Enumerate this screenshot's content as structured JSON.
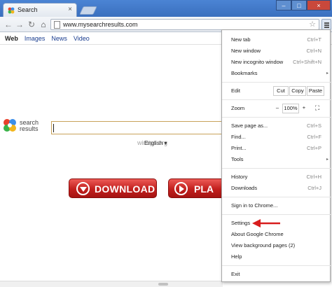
{
  "tab": {
    "title": "Search",
    "close": "×"
  },
  "toolbar": {
    "back": "←",
    "forward": "→",
    "reload": "↻",
    "home": "⌂",
    "url": "www.mysearchresults.com",
    "star": "☆"
  },
  "window_controls": {
    "minimize": "–",
    "maximize": "□",
    "close": "×"
  },
  "page": {
    "tabs": [
      "Web",
      "Images",
      "News",
      "Video"
    ],
    "logo_text_line1": "search",
    "logo_text_line2": "results",
    "language": "English ▾",
    "watermark": "wintips.org",
    "download_label": "DOWNLOAD",
    "play_label": "PLA"
  },
  "menu": {
    "items": [
      {
        "label": "New tab",
        "shortcut": "Ctrl+T"
      },
      {
        "label": "New window",
        "shortcut": "Ctrl+N"
      },
      {
        "label": "New incognito window",
        "shortcut": "Ctrl+Shift+N"
      },
      {
        "label": "Bookmarks",
        "shortcut": ""
      },
      {
        "label": "Edit",
        "shortcut": ""
      },
      {
        "label": "Zoom",
        "shortcut": ""
      },
      {
        "label": "Save page as...",
        "shortcut": "Ctrl+S"
      },
      {
        "label": "Find...",
        "shortcut": "Ctrl+F"
      },
      {
        "label": "Print...",
        "shortcut": "Ctrl+P"
      },
      {
        "label": "Tools",
        "shortcut": ""
      },
      {
        "label": "History",
        "shortcut": "Ctrl+H"
      },
      {
        "label": "Downloads",
        "shortcut": "Ctrl+J"
      },
      {
        "label": "Sign in to Chrome...",
        "shortcut": ""
      },
      {
        "label": "Settings",
        "shortcut": ""
      },
      {
        "label": "About Google Chrome",
        "shortcut": ""
      },
      {
        "label": "View background pages (2)",
        "shortcut": ""
      },
      {
        "label": "Help",
        "shortcut": ""
      },
      {
        "label": "Exit",
        "shortcut": ""
      }
    ],
    "edit": {
      "cut": "Cut",
      "copy": "Copy",
      "paste": "Paste"
    },
    "zoom": {
      "minus": "–",
      "level": "100%",
      "plus": "+",
      "fullscreen": "⛶"
    },
    "submenu_arrow": "▸"
  },
  "colors": {
    "titlebar": "#3a6fbe",
    "accent_red": "#c21f1d",
    "link": "#1a3d8f"
  }
}
